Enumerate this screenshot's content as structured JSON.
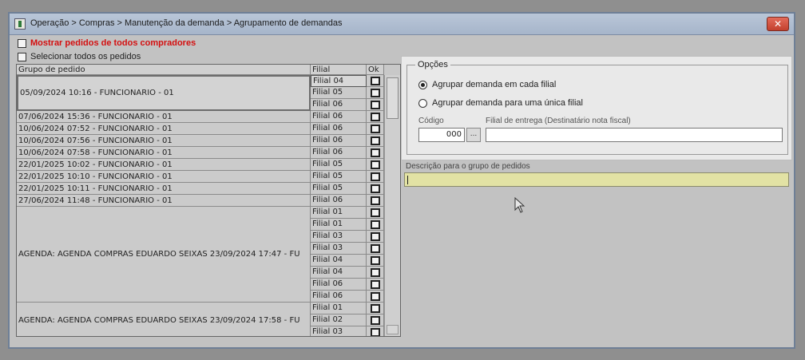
{
  "window": {
    "title": "Operação > Compras > Manutenção da demanda > Agrupamento de demandas",
    "close_glyph": "✕"
  },
  "options_top": {
    "show_all_buyers": "Mostrar pedidos de todos compradores",
    "select_all_orders": "Selecionar todos os pedidos"
  },
  "grid": {
    "headers": {
      "grupo": "Grupo de pedido",
      "filial": "Filial",
      "ok": "Ok"
    },
    "groups": [
      "05/09/2024 10:16 - FUNCIONARIO - 01",
      "07/06/2024 15:36 - FUNCIONARIO - 01",
      "10/06/2024 07:52 - FUNCIONARIO - 01",
      "10/06/2024 07:56 - FUNCIONARIO - 01",
      "10/06/2024 07:58 - FUNCIONARIO - 01",
      "22/01/2025 10:02 - FUNCIONARIO - 01",
      "22/01/2025 10:10 - FUNCIONARIO - 01",
      "22/01/2025 10:11 - FUNCIONARIO - 01",
      "27/06/2024 11:48 - FUNCIONARIO - 01",
      "AGENDA: AGENDA COMPRAS EDUARDO SEIXAS 23/09/2024 17:47 - FU",
      "AGENDA: AGENDA COMPRAS EDUARDO SEIXAS 23/09/2024 17:58 - FU"
    ],
    "filiais": [
      "Filial 04",
      "Filial 05",
      "Filial 06",
      "Filial 06",
      "Filial 06",
      "Filial 06",
      "Filial 06",
      "Filial 05",
      "Filial 05",
      "Filial 05",
      "Filial 06",
      "Filial 01",
      "Filial 01",
      "Filial 03",
      "Filial 03",
      "Filial 04",
      "Filial 04",
      "Filial 06",
      "Filial 06",
      "Filial 01",
      "Filial 02",
      "Filial 03"
    ]
  },
  "opcoes": {
    "legend": "Opções",
    "radio_cada_filial": "Agrupar demanda em cada filial",
    "radio_unica_filial": "Agrupar demanda para uma única filial",
    "codigo_label": "Código",
    "codigo_value": "000",
    "dots_label": "...",
    "filial_entrega_label": "Filial de entrega (Destinatário nota fiscal)"
  },
  "descricao": {
    "label": "Descrição para o grupo de pedidos",
    "value": ""
  }
}
